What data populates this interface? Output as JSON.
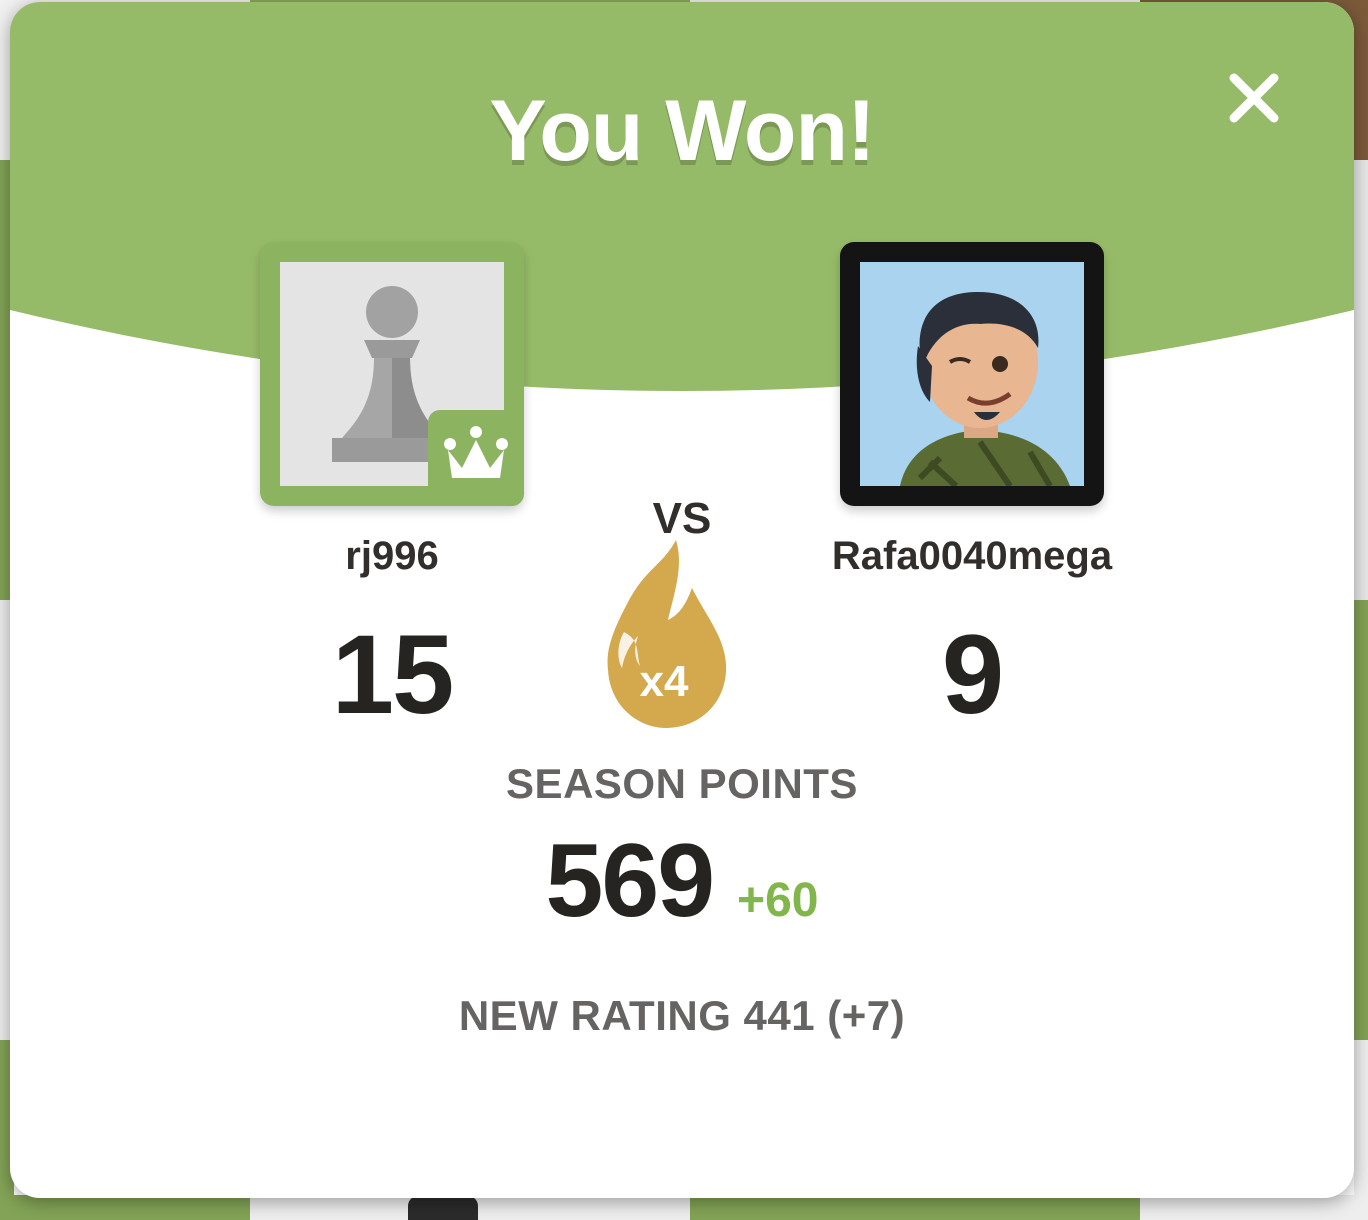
{
  "modal": {
    "title": "You Won!",
    "close_icon": "close-icon"
  },
  "players": {
    "me": {
      "name": "rj996",
      "score": "15",
      "avatar_icon": "pawn-icon",
      "badge_icon": "crown-icon"
    },
    "opponent": {
      "name": "Rafa0040mega",
      "score": "9",
      "avatar_icon": "user-avatar"
    }
  },
  "versus": {
    "label": "VS",
    "streak_icon": "flame-icon",
    "multiplier": "x4"
  },
  "season": {
    "label": "SEASON POINTS",
    "points": "569",
    "delta": "+60"
  },
  "rating": {
    "text": "NEW RATING 441 (+7)"
  },
  "colors": {
    "header_green": "#96bb68",
    "accent_green": "#81b64c",
    "flame_gold": "#d4a94e",
    "text_dark": "#262421",
    "text_gray": "#666463"
  }
}
